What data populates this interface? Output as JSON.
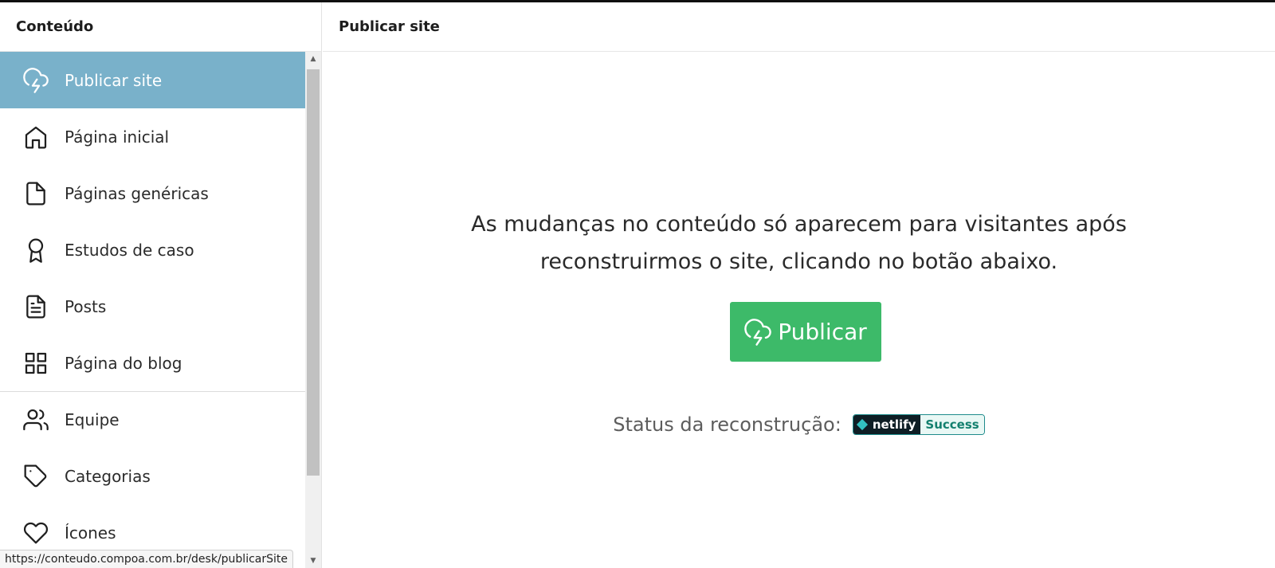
{
  "sidebar": {
    "title": "Conteúdo",
    "items": [
      {
        "label": "Publicar site",
        "icon": "cloud-lightning-icon",
        "active": true
      },
      {
        "label": "Página inicial",
        "icon": "home-icon"
      },
      {
        "label": "Páginas genéricas",
        "icon": "file-icon"
      },
      {
        "label": "Estudos de caso",
        "icon": "award-icon"
      },
      {
        "label": "Posts",
        "icon": "file-text-icon"
      },
      {
        "label": "Página do blog",
        "icon": "grid-icon"
      },
      {
        "label": "Equipe",
        "icon": "users-icon"
      },
      {
        "label": "Categorias",
        "icon": "tag-icon"
      },
      {
        "label": "Ícones",
        "icon": "heart-icon"
      }
    ]
  },
  "main": {
    "title": "Publicar site",
    "message_line1": "As mudanças no conteúdo só aparecem para visitantes após",
    "message_line2": "reconstruirmos o site, clicando no botão abaixo.",
    "publish_label": "Publicar",
    "status_label": "Status da reconstrução:",
    "badge_left": "netlify",
    "badge_right": "Success"
  },
  "statusbar": {
    "url": "https://conteudo.compoa.com.br/desk/publicarSite"
  },
  "colors": {
    "active_item": "#79b1ca",
    "publish_button": "#3dba69",
    "badge_dark": "#0e1e25",
    "badge_success": "#14806f"
  }
}
